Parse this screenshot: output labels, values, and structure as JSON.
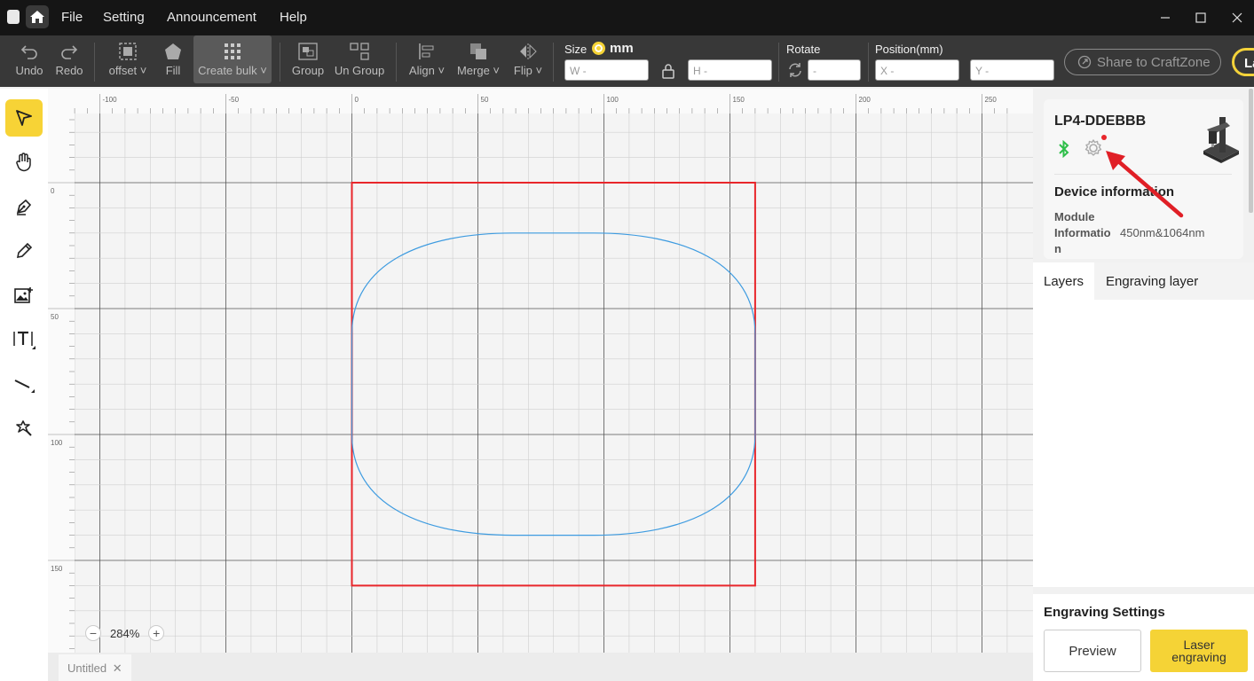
{
  "menu": {
    "file": "File",
    "setting": "Setting",
    "announcement": "Announcement",
    "help": "Help"
  },
  "toolbar": {
    "undo": "Undo",
    "redo": "Redo",
    "offset": "offset",
    "fill": "Fill",
    "create_bulk": "Create bulk",
    "group": "Group",
    "ungroup": "Un Group",
    "align": "Align",
    "merge": "Merge",
    "flip": "Flip",
    "size_label": "Size",
    "size_unit": "mm",
    "w_placeholder": "W -",
    "h_placeholder": "H -",
    "rotate_label": "Rotate",
    "rotate_placeholder": "-",
    "position_label": "Position(mm)",
    "x_placeholder": "X -",
    "y_placeholder": "Y -",
    "share": "Share to CraftZone",
    "laser_short": "La"
  },
  "ruler": {
    "x_ticks": [
      "-100",
      "-50",
      "0",
      "50",
      "100",
      "150",
      "200",
      "250"
    ],
    "y_ticks": [
      "0",
      "50",
      "100",
      "150"
    ]
  },
  "zoom": "284%",
  "document_tab": "Untitled",
  "device": {
    "name": "LP4-DDEBBB",
    "info_title": "Device information",
    "module_label": "Module Informatio n",
    "module_value": "450nm&1064nm"
  },
  "layers": {
    "tab_layers": "Layers",
    "tab_engraving": "Engraving layer"
  },
  "engraving": {
    "title": "Engraving Settings",
    "preview": "Preview",
    "laser": "Laser engraving"
  },
  "colors": {
    "accent": "#f5d336",
    "selection": "#e8262b",
    "path": "#3d9be0",
    "bluetooth": "#2fbf4a"
  }
}
